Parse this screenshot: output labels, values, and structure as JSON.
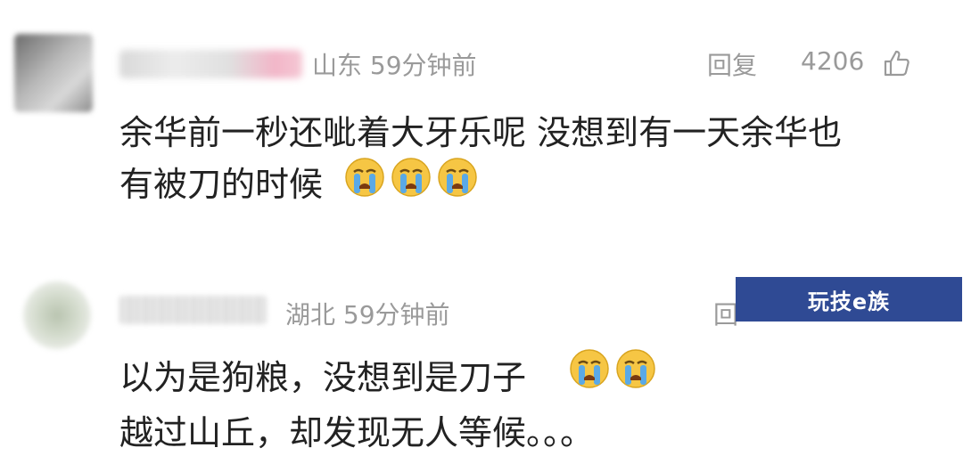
{
  "comments": [
    {
      "location_time": "山东 59分钟前",
      "reply_label": "回复",
      "like_count": "4206",
      "text_line1": "余华前一秒还呲着大牙乐呢 没想到有一天余华也",
      "text_line2": "有被刀的时候",
      "emojis": [
        "crying-face",
        "crying-face",
        "crying-face"
      ]
    },
    {
      "location_time": "湖北 59分钟前",
      "reply_label": "回",
      "text_line1": "以为是狗粮，没想到是刀子",
      "text_line2": "越过山丘，却发现无人等候。。。",
      "emojis": [
        "crying-face",
        "crying-face"
      ]
    }
  ],
  "watermark": {
    "text": "玩技e族",
    "background": "#2f4a94"
  },
  "colors": {
    "meta_text": "#9a9a9a",
    "body_text": "#222222",
    "emoji_face": "#f6c644",
    "emoji_tears": "#5aa9e6"
  }
}
